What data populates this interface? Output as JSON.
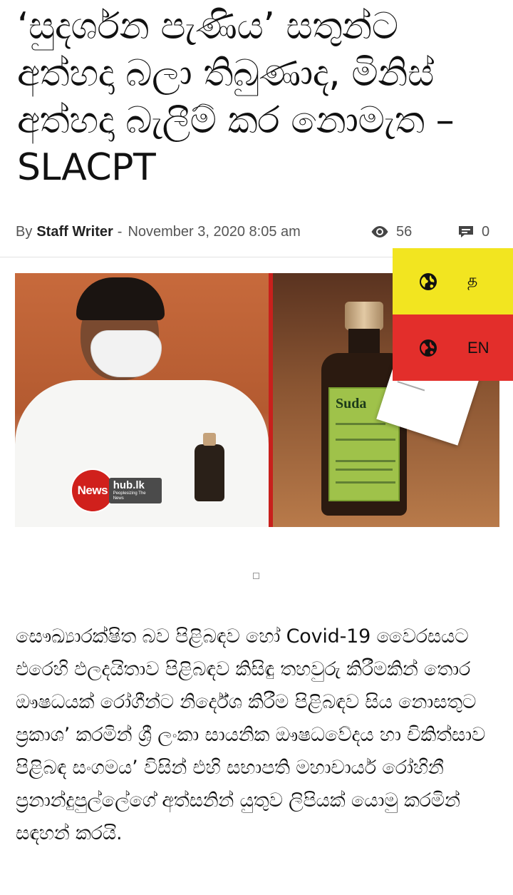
{
  "article": {
    "title": "‘සුදර්ශන පැණිය’ සතුන්ට අත්හදා බලා තිබුණාද, මිනිස් අත්හදා බැලීම් කර නොමැත – SLACPT",
    "meta": {
      "by_label": "By",
      "author": "Staff Writer",
      "separator": "-",
      "date": "November 3, 2020 8:05 am",
      "views_icon": "eye-icon",
      "views_count": "56",
      "comments_icon": "comment-icon",
      "comments_count": "0"
    },
    "image": {
      "logo_news": "News",
      "logo_hub": "hub.lk",
      "logo_tagline": "Peoplesizing The News",
      "bottle_label": "Suda"
    },
    "body": "සෞඛ්‍යාරක්ෂිත බව පිළිබඳව හෝ Covid-19 වෛරසයට එරෙහි ඵලදයිතාව පිළිබඳව කිසිඳු තහවුරු කිරීමකින් තොර ඖෂධයක් රෝගීන්ට නිර්දේශ කිරීම පිළිබඳව සිය නොසතුට ප්‍රකාශ’ කරමින් ශ්‍රී ලංකා සායනික ඖෂධවේදය හා චිකිත්සාව පිළිබඳ සංගමය’ විසින් එහි සභාපති මහාචාර්ය රෝහිනී ප්‍රනාන්දුපුල්ලේගේ අත්සනින් යුතුව ලිපියක් යොමු කරමින් සඳහන් කරයි."
  },
  "language_switcher": {
    "options": [
      {
        "label": "த",
        "icon": "globe-icon",
        "color": "#f2e520"
      },
      {
        "label": "EN",
        "icon": "globe-icon",
        "color": "#e32e2b"
      }
    ]
  }
}
